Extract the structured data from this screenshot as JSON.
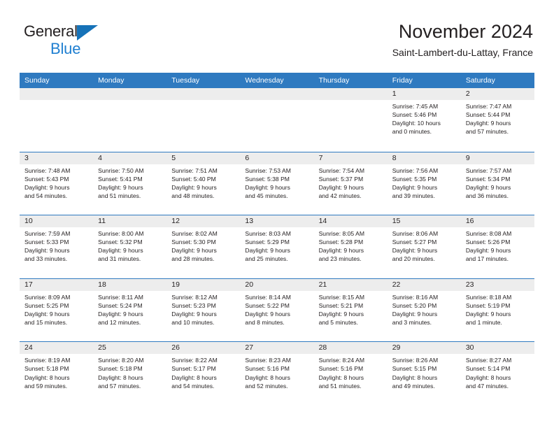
{
  "brand": {
    "name_part1": "General",
    "name_part2": "Blue",
    "triangle_color": "#1672b8",
    "blue_text_color": "#1f7fd1"
  },
  "header": {
    "month_title": "November 2024",
    "location": "Saint-Lambert-du-Lattay, France"
  },
  "theme": {
    "header_bar_color": "#2f7ac0",
    "day_strip_color": "#ededed",
    "text_color": "#231f20"
  },
  "calendar": {
    "weekdays": [
      "Sunday",
      "Monday",
      "Tuesday",
      "Wednesday",
      "Thursday",
      "Friday",
      "Saturday"
    ],
    "weeks": [
      [
        {
          "day": "",
          "empty": true
        },
        {
          "day": "",
          "empty": true
        },
        {
          "day": "",
          "empty": true
        },
        {
          "day": "",
          "empty": true
        },
        {
          "day": "",
          "empty": true
        },
        {
          "day": "1",
          "sunrise": "Sunrise: 7:45 AM",
          "sunset": "Sunset: 5:46 PM",
          "daylight_line1": "Daylight: 10 hours",
          "daylight_line2": "and 0 minutes."
        },
        {
          "day": "2",
          "sunrise": "Sunrise: 7:47 AM",
          "sunset": "Sunset: 5:44 PM",
          "daylight_line1": "Daylight: 9 hours",
          "daylight_line2": "and 57 minutes."
        }
      ],
      [
        {
          "day": "3",
          "sunrise": "Sunrise: 7:48 AM",
          "sunset": "Sunset: 5:43 PM",
          "daylight_line1": "Daylight: 9 hours",
          "daylight_line2": "and 54 minutes."
        },
        {
          "day": "4",
          "sunrise": "Sunrise: 7:50 AM",
          "sunset": "Sunset: 5:41 PM",
          "daylight_line1": "Daylight: 9 hours",
          "daylight_line2": "and 51 minutes."
        },
        {
          "day": "5",
          "sunrise": "Sunrise: 7:51 AM",
          "sunset": "Sunset: 5:40 PM",
          "daylight_line1": "Daylight: 9 hours",
          "daylight_line2": "and 48 minutes."
        },
        {
          "day": "6",
          "sunrise": "Sunrise: 7:53 AM",
          "sunset": "Sunset: 5:38 PM",
          "daylight_line1": "Daylight: 9 hours",
          "daylight_line2": "and 45 minutes."
        },
        {
          "day": "7",
          "sunrise": "Sunrise: 7:54 AM",
          "sunset": "Sunset: 5:37 PM",
          "daylight_line1": "Daylight: 9 hours",
          "daylight_line2": "and 42 minutes."
        },
        {
          "day": "8",
          "sunrise": "Sunrise: 7:56 AM",
          "sunset": "Sunset: 5:35 PM",
          "daylight_line1": "Daylight: 9 hours",
          "daylight_line2": "and 39 minutes."
        },
        {
          "day": "9",
          "sunrise": "Sunrise: 7:57 AM",
          "sunset": "Sunset: 5:34 PM",
          "daylight_line1": "Daylight: 9 hours",
          "daylight_line2": "and 36 minutes."
        }
      ],
      [
        {
          "day": "10",
          "sunrise": "Sunrise: 7:59 AM",
          "sunset": "Sunset: 5:33 PM",
          "daylight_line1": "Daylight: 9 hours",
          "daylight_line2": "and 33 minutes."
        },
        {
          "day": "11",
          "sunrise": "Sunrise: 8:00 AM",
          "sunset": "Sunset: 5:32 PM",
          "daylight_line1": "Daylight: 9 hours",
          "daylight_line2": "and 31 minutes."
        },
        {
          "day": "12",
          "sunrise": "Sunrise: 8:02 AM",
          "sunset": "Sunset: 5:30 PM",
          "daylight_line1": "Daylight: 9 hours",
          "daylight_line2": "and 28 minutes."
        },
        {
          "day": "13",
          "sunrise": "Sunrise: 8:03 AM",
          "sunset": "Sunset: 5:29 PM",
          "daylight_line1": "Daylight: 9 hours",
          "daylight_line2": "and 25 minutes."
        },
        {
          "day": "14",
          "sunrise": "Sunrise: 8:05 AM",
          "sunset": "Sunset: 5:28 PM",
          "daylight_line1": "Daylight: 9 hours",
          "daylight_line2": "and 23 minutes."
        },
        {
          "day": "15",
          "sunrise": "Sunrise: 8:06 AM",
          "sunset": "Sunset: 5:27 PM",
          "daylight_line1": "Daylight: 9 hours",
          "daylight_line2": "and 20 minutes."
        },
        {
          "day": "16",
          "sunrise": "Sunrise: 8:08 AM",
          "sunset": "Sunset: 5:26 PM",
          "daylight_line1": "Daylight: 9 hours",
          "daylight_line2": "and 17 minutes."
        }
      ],
      [
        {
          "day": "17",
          "sunrise": "Sunrise: 8:09 AM",
          "sunset": "Sunset: 5:25 PM",
          "daylight_line1": "Daylight: 9 hours",
          "daylight_line2": "and 15 minutes."
        },
        {
          "day": "18",
          "sunrise": "Sunrise: 8:11 AM",
          "sunset": "Sunset: 5:24 PM",
          "daylight_line1": "Daylight: 9 hours",
          "daylight_line2": "and 12 minutes."
        },
        {
          "day": "19",
          "sunrise": "Sunrise: 8:12 AM",
          "sunset": "Sunset: 5:23 PM",
          "daylight_line1": "Daylight: 9 hours",
          "daylight_line2": "and 10 minutes."
        },
        {
          "day": "20",
          "sunrise": "Sunrise: 8:14 AM",
          "sunset": "Sunset: 5:22 PM",
          "daylight_line1": "Daylight: 9 hours",
          "daylight_line2": "and 8 minutes."
        },
        {
          "day": "21",
          "sunrise": "Sunrise: 8:15 AM",
          "sunset": "Sunset: 5:21 PM",
          "daylight_line1": "Daylight: 9 hours",
          "daylight_line2": "and 5 minutes."
        },
        {
          "day": "22",
          "sunrise": "Sunrise: 8:16 AM",
          "sunset": "Sunset: 5:20 PM",
          "daylight_line1": "Daylight: 9 hours",
          "daylight_line2": "and 3 minutes."
        },
        {
          "day": "23",
          "sunrise": "Sunrise: 8:18 AM",
          "sunset": "Sunset: 5:19 PM",
          "daylight_line1": "Daylight: 9 hours",
          "daylight_line2": "and 1 minute."
        }
      ],
      [
        {
          "day": "24",
          "sunrise": "Sunrise: 8:19 AM",
          "sunset": "Sunset: 5:18 PM",
          "daylight_line1": "Daylight: 8 hours",
          "daylight_line2": "and 59 minutes."
        },
        {
          "day": "25",
          "sunrise": "Sunrise: 8:20 AM",
          "sunset": "Sunset: 5:18 PM",
          "daylight_line1": "Daylight: 8 hours",
          "daylight_line2": "and 57 minutes."
        },
        {
          "day": "26",
          "sunrise": "Sunrise: 8:22 AM",
          "sunset": "Sunset: 5:17 PM",
          "daylight_line1": "Daylight: 8 hours",
          "daylight_line2": "and 54 minutes."
        },
        {
          "day": "27",
          "sunrise": "Sunrise: 8:23 AM",
          "sunset": "Sunset: 5:16 PM",
          "daylight_line1": "Daylight: 8 hours",
          "daylight_line2": "and 52 minutes."
        },
        {
          "day": "28",
          "sunrise": "Sunrise: 8:24 AM",
          "sunset": "Sunset: 5:16 PM",
          "daylight_line1": "Daylight: 8 hours",
          "daylight_line2": "and 51 minutes."
        },
        {
          "day": "29",
          "sunrise": "Sunrise: 8:26 AM",
          "sunset": "Sunset: 5:15 PM",
          "daylight_line1": "Daylight: 8 hours",
          "daylight_line2": "and 49 minutes."
        },
        {
          "day": "30",
          "sunrise": "Sunrise: 8:27 AM",
          "sunset": "Sunset: 5:14 PM",
          "daylight_line1": "Daylight: 8 hours",
          "daylight_line2": "and 47 minutes."
        }
      ]
    ]
  }
}
